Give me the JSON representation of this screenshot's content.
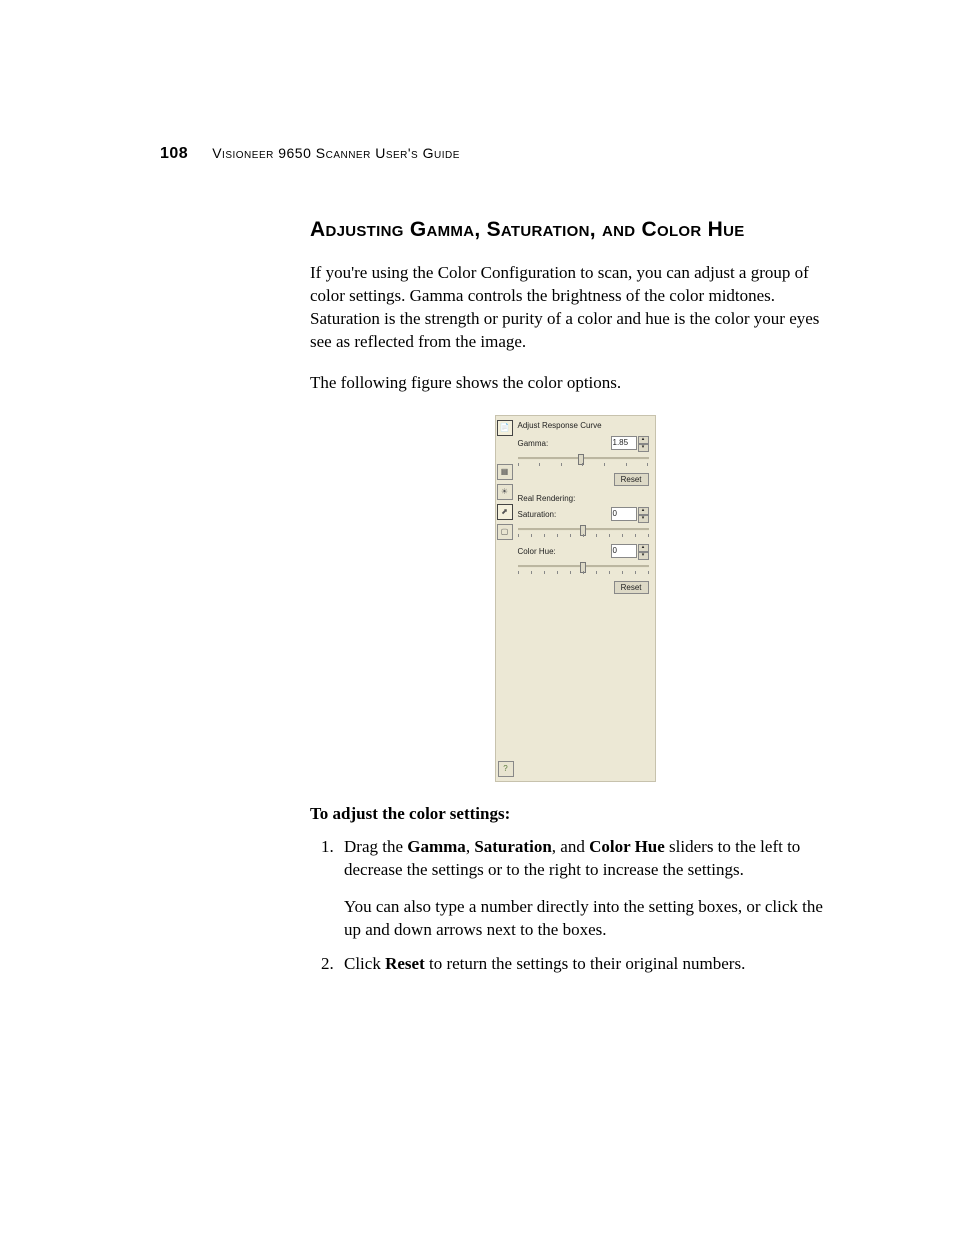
{
  "header": {
    "page_number": "108",
    "running_title": "Visioneer 9650 Scanner User's Guide"
  },
  "heading": "Adjusting Gamma, Saturation, and Color Hue",
  "intro_para": "If you're using the Color Configuration to scan, you can adjust a group of color settings. Gamma controls the brightness of the color midtones. Saturation is the strength or purity of a color and hue is the color your eyes see as reflected from the image.",
  "lead_in": "The following figure shows the color options.",
  "figure": {
    "panel_title": "Adjust Response Curve",
    "gamma": {
      "label": "Gamma:",
      "value": "1.85",
      "reset": "Reset"
    },
    "real_rendering_label": "Real Rendering:",
    "saturation": {
      "label": "Saturation:",
      "value": "0"
    },
    "color_hue": {
      "label": "Color Hue:",
      "value": "0",
      "reset": "Reset"
    },
    "icons": {
      "top": "file-icon",
      "grid": "grid-icon",
      "brightness": "brightness-icon",
      "curve": "curve-icon",
      "crop": "crop-icon",
      "help": "help-icon"
    }
  },
  "subhead": "To adjust the color settings:",
  "steps": {
    "s1_pre": "Drag the ",
    "s1_b1": "Gamma",
    "s1_mid1": ", ",
    "s1_b2": "Saturation",
    "s1_mid2": ", and ",
    "s1_b3": "Color Hue",
    "s1_post": " sliders to the left to decrease the settings or to the right to increase the settings.",
    "s1_para2": "You can also type a number directly into the setting boxes, or click the up and down arrows next to the boxes.",
    "s2_pre": "Click ",
    "s2_b1": "Reset",
    "s2_post": " to return the settings to their original numbers."
  }
}
